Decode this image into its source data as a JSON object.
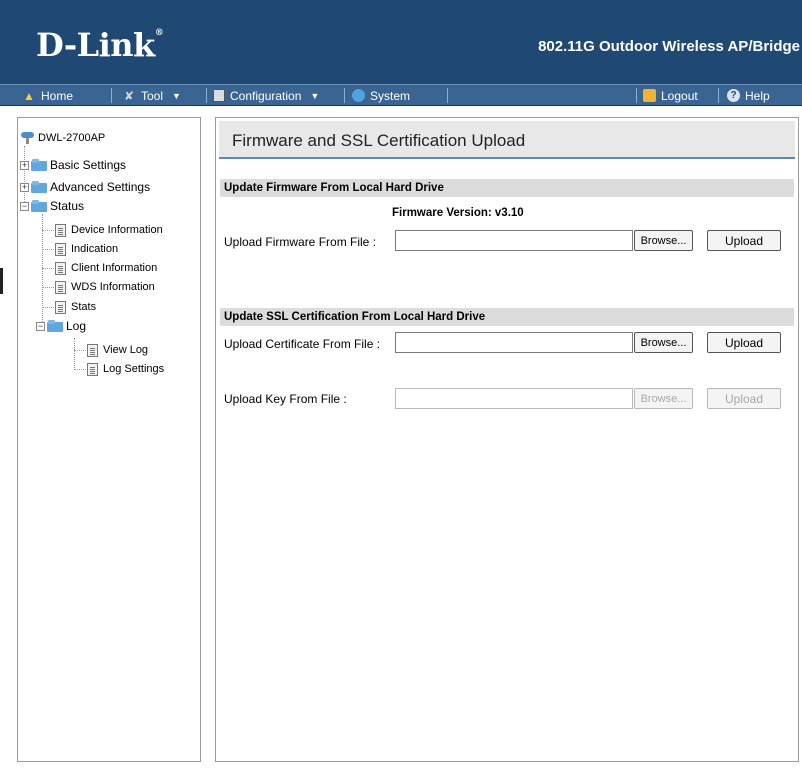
{
  "header": {
    "logo_text": "D-Link",
    "logo_mark": "®",
    "product_title": "802.11G Outdoor Wireless AP/Bridge",
    "bg_color": "#1f4873"
  },
  "menubar": {
    "home": {
      "label": "Home",
      "icon": "home-icon"
    },
    "tool": {
      "label": "Tool",
      "icon": "tool-icon"
    },
    "configuration": {
      "label": "Configuration",
      "icon": "disk-icon"
    },
    "system": {
      "label": "System",
      "icon": "globe-icon"
    },
    "logout": {
      "label": "Logout",
      "icon": "logout-icon"
    },
    "help": {
      "label": "Help",
      "icon": "help-icon"
    }
  },
  "sidebar": {
    "root": "DWL-2700AP",
    "basic_settings": "Basic Settings",
    "advanced_settings": "Advanced Settings",
    "status": "Status",
    "device_information": "Device Information",
    "indication": "Indication",
    "client_information": "Client Information",
    "wds_information": "WDS Information",
    "stats": "Stats",
    "log": "Log",
    "view_log": "View Log",
    "log_settings": "Log Settings"
  },
  "content": {
    "title": "Firmware and SSL Certification Upload",
    "firmware_section": "Update Firmware From Local Hard Drive",
    "firmware_version": "Firmware Version: v3.10",
    "firmware_label": "Upload Firmware From File :",
    "ssl_section": "Update SSL Certification From Local Hard Drive",
    "cert_label": "Upload Certificate From File :",
    "key_label": "Upload Key From File :",
    "browse_label": "Browse...",
    "upload_label": "Upload",
    "firmware_value": "",
    "cert_value": "",
    "key_value": ""
  },
  "colors": {
    "menu_bar": "#3a6593",
    "section_header": "#dcdcdc",
    "title_bar": "#e8e8e8",
    "accent": "#5b87b3"
  }
}
